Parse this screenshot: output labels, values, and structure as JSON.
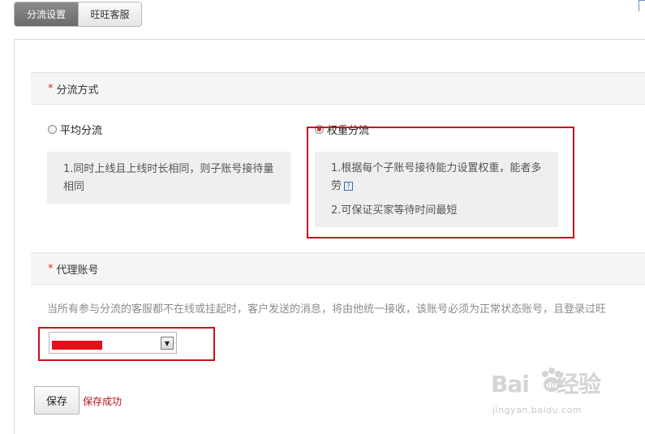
{
  "tabs": [
    {
      "label": "分流设置",
      "active": true
    },
    {
      "label": "旺旺客服",
      "active": false
    }
  ],
  "distribution": {
    "heading_star": "*",
    "heading": "分流方式",
    "options": [
      {
        "label": "平均分流",
        "selected": false,
        "desc": [
          "1.同时上线且上线时长相同，则子账号接待量相同"
        ]
      },
      {
        "label": "权重分流",
        "selected": true,
        "desc": [
          "1.根据每个子账号接待能力设置权重，能者多劳",
          "2.可保证买家等待时间最短"
        ]
      }
    ]
  },
  "proxy": {
    "heading_star": "*",
    "heading": "代理账号",
    "notice": "当所有参与分流的客服都不在线或挂起时，客户发送的消息，将由他统一接收，该账号必须为正常状态账号，且登录过旺",
    "select_arrow": "▼"
  },
  "actions": {
    "save_label": "保存",
    "save_status": "保存成功"
  },
  "watermark": {
    "logo_a": "Bai",
    "logo_b": "经验",
    "url": "jingyan.baidu.com"
  },
  "colors": {
    "highlight": "#c8101a",
    "required_star": "#d52b1e",
    "status_text": "#c0101a"
  }
}
